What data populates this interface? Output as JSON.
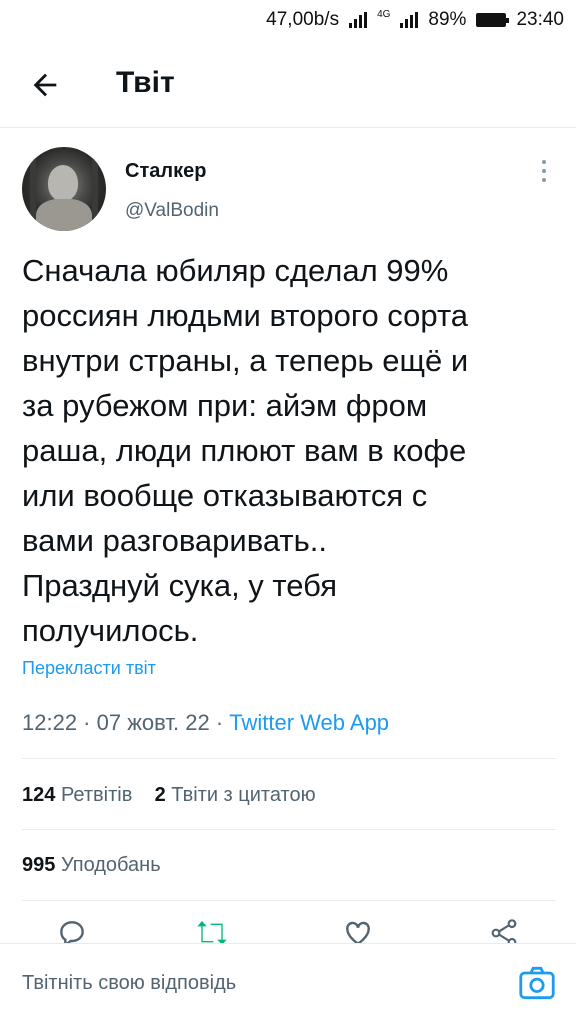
{
  "status_bar": {
    "speed": "47,00b/s",
    "network": "4G",
    "battery": "89%",
    "time": "23:40"
  },
  "header": {
    "title": "Твіт",
    "back_icon": "arrow-left-icon"
  },
  "tweet": {
    "author_name": "Сталкер",
    "author_handle": "@ValBodin",
    "text": "Сначала юбиляр сделал 99%\nроссиян людьми второго сорта\nвнутри страны, а теперь ещё и\nза рубежом при: айэм фром\nраша, люди плюют вам в кофе\nили вообще отказываются с\nвами разговаривать..\nПразднуй сука, у тебя\nполучилось.",
    "translate_label": "Перекласти твіт",
    "time": "12:22",
    "date": "07 жовт. 22",
    "source": "Twitter Web App",
    "separator": " · "
  },
  "stats": {
    "retweets_count": "124",
    "retweets_label": "Ретвітів",
    "quotes_count": "2",
    "quotes_label": "Твіти з цитатою",
    "likes_count": "995",
    "likes_label": "Уподобань"
  },
  "actions": {
    "icons": [
      "reply-icon",
      "retweet-icon",
      "like-icon",
      "share-icon"
    ]
  },
  "reply_bar": {
    "placeholder": "Твітніть свою відповідь",
    "camera_icon": "camera-icon"
  },
  "colors": {
    "accent": "#1d9bf0",
    "text": "#0f1419",
    "secondary": "#536471",
    "retweet": "#00ba7c",
    "divider": "#e6ecf0"
  }
}
